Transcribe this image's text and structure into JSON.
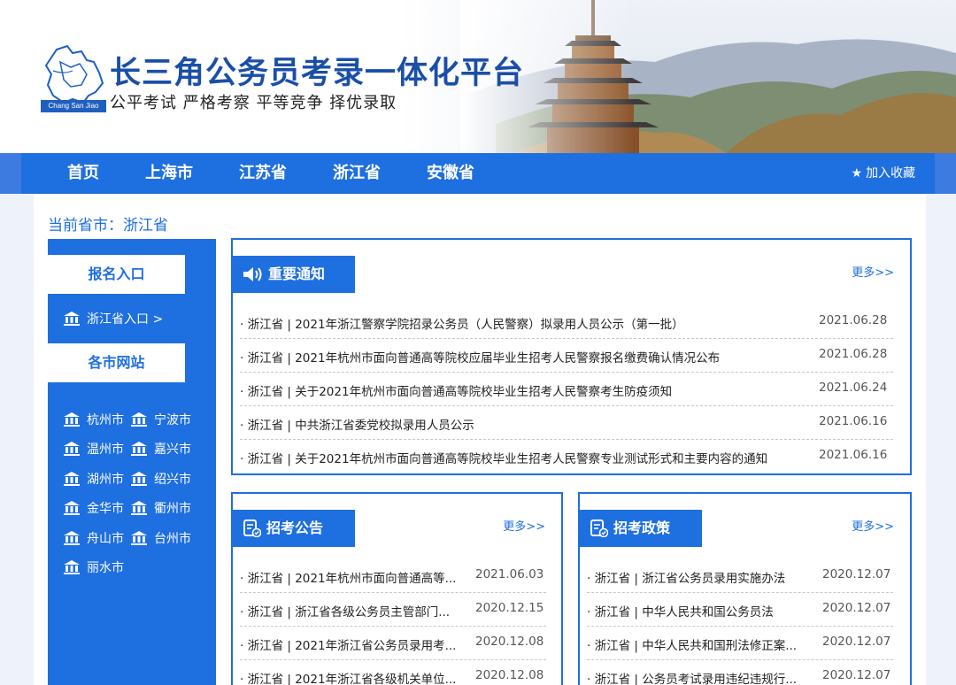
{
  "banner": {
    "title": "长三角公务员考录一体化平台",
    "slogan": "公平考试 严格考察 平等竞争 择优录取",
    "logo_caption": "Chang San Jiao"
  },
  "nav": {
    "items": [
      {
        "label": "首页"
      },
      {
        "label": "上海市"
      },
      {
        "label": "江苏省"
      },
      {
        "label": "浙江省"
      },
      {
        "label": "安徽省"
      }
    ],
    "favorite": "加入收藏"
  },
  "current_location": "当前省市：浙江省",
  "sidebar": {
    "signup_header": "报名入口",
    "signup_link": "浙江省入口 >",
    "cities_header": "各市网站",
    "cities": [
      "杭州市",
      "宁波市",
      "温州市",
      "嘉兴市",
      "湖州市",
      "绍兴市",
      "金华市",
      "衢州市",
      "舟山市",
      "台州市",
      "丽水市"
    ]
  },
  "notice": {
    "title": "重要通知",
    "more": "更多>>",
    "items": [
      {
        "text": "· 浙江省 | 2021年浙江警察学院招录公务员（人民警察）拟录用人员公示（第一批）",
        "date": "2021.06.28"
      },
      {
        "text": "· 浙江省 | 2021年杭州市面向普通高等院校应届毕业生招考人民警察报名缴费确认情况公布",
        "date": "2021.06.28"
      },
      {
        "text": "· 浙江省 | 关于2021年杭州市面向普通高等院校毕业生招考人民警察考生防疫须知",
        "date": "2021.06.24"
      },
      {
        "text": "· 浙江省 | 中共浙江省委党校拟录用人员公示",
        "date": "2021.06.16"
      },
      {
        "text": "· 浙江省 | 关于2021年杭州市面向普通高等院校毕业生招考人民警察专业测试形式和主要内容的通知",
        "date": "2021.06.16"
      }
    ]
  },
  "announce": {
    "title": "招考公告",
    "more": "更多>>",
    "items": [
      {
        "text": "· 浙江省 | 2021年杭州市面向普通高等...",
        "date": "2021.06.03"
      },
      {
        "text": "· 浙江省 | 浙江省各级公务员主管部门...",
        "date": "2020.12.15"
      },
      {
        "text": "· 浙江省 | 2021年浙江省公务员录用考...",
        "date": "2020.12.08"
      },
      {
        "text": "· 浙江省 | 2021年浙江省各级机关单位...",
        "date": "2020.12.08"
      }
    ]
  },
  "policy": {
    "title": "招考政策",
    "more": "更多>>",
    "items": [
      {
        "text": "· 浙江省 | 浙江省公务员录用实施办法",
        "date": "2020.12.07"
      },
      {
        "text": "· 浙江省 | 中华人民共和国公务员法",
        "date": "2020.12.07"
      },
      {
        "text": "· 浙江省 | 中华人民共和国刑法修正案...",
        "date": "2020.12.07"
      },
      {
        "text": "· 浙江省 | 公务员考试录用违纪违规行...",
        "date": "2020.12.07"
      }
    ]
  },
  "colors": {
    "primary": "#1e6fe0",
    "title_blue": "#1a4fa8"
  }
}
